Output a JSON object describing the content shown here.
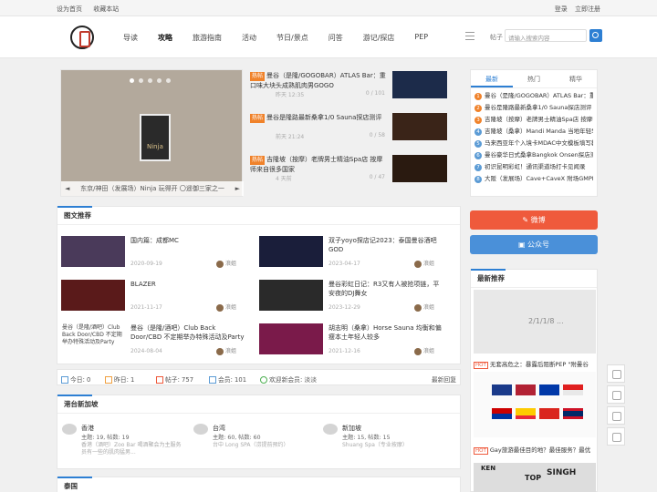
{
  "topbar": {
    "left": [
      "设为首页",
      "收藏本站"
    ],
    "right": [
      "登录",
      "立即注册"
    ]
  },
  "nav": [
    "导读",
    "攻略",
    "旅游指南",
    "活动",
    "节日/景点",
    "问答",
    "游记/探店",
    "PEP"
  ],
  "search": {
    "label": "帖子",
    "placeholder": "请输入搜索内容"
  },
  "slider": {
    "caption": "东京/神田（发展场）Ninja 玩得开 〇遥御三家之一",
    "poster_text": "Ninja"
  },
  "headlines": [
    {
      "tag": "热帖",
      "title": "曼谷（是隆/GOGOBAR）ATLAS Bar：重口味大块头成熟肌肉男GOGO",
      "time": "昨天 12:35",
      "count": "0 / 101"
    },
    {
      "tag": "热帖",
      "title": "曼谷是隆路最新桑拿1/0 Sauna探店测评",
      "time": "前天 21:24",
      "count": "0 / 58"
    },
    {
      "tag": "热帖",
      "title": "吉隆坡（按摩）老牌男士精油Spa店 按摩师来自很多国家",
      "time": "4 天前",
      "count": "0 / 47"
    }
  ],
  "tabs": {
    "labels": [
      "最新",
      "热门",
      "精华"
    ],
    "items": [
      "曼谷（是隆/GOGOBAR）ATLAS Bar：重口",
      "曼谷是隆路最新桑拿1/0 Sauna探店测评",
      "吉隆坡（按摩）老牌男士精油Spa店 按摩师",
      "吉隆坡（桑拿）Mandi Manda 当地年轻华人",
      "马来西亚年个入境卡MDAC中文模板填写教",
      "曼谷豪华日式桑拿Bangkok Onsen探店测记",
      "初识昆明彩虹！通讯渠道场打卡见闻录",
      "大阪（发展场）Cave+CaveX 附场GMPD和"
    ]
  },
  "buttons": {
    "weibo": "微博",
    "wechat": "公众号"
  },
  "gallery": {
    "title": "图文推荐",
    "items": [
      {
        "title": "国内篇：成都MC",
        "date": "2020-09-19",
        "author": "浪姐"
      },
      {
        "title": "双子yoyo探店记2023：泰国曼谷酒吧GOD",
        "date": "2023-04-17",
        "author": "浪姐"
      },
      {
        "title": "BLAZER",
        "date": "2021-11-17",
        "author": "浪姐"
      },
      {
        "title": "曼谷彩虹日记：R3又有人被抢项链，平安夜的DJ舞女",
        "date": "2023-12-29",
        "author": "浪姐"
      },
      {
        "title": "曼谷（是隆/酒吧）Club Back Door/CBD 不定期举办特殊活动及Party",
        "date": "2024-08-04",
        "author": "浪姐"
      },
      {
        "title": "胡志明（桑拿）Horse Sauna 均衡和偏瘦本土年轻人较多",
        "date": "2021-12-16",
        "author": "浪姐"
      }
    ],
    "broken_alt": "曼谷（是隆/酒吧）Club Back Door/CBD 不定期举办特殊活动及Party"
  },
  "stats": {
    "today": "今日: 0",
    "yesterday": "昨日: 1",
    "posts": "帖子: 757",
    "members": "会员: 101",
    "welcome": "欢迎新会员: 淡淡",
    "latest": "最新回复"
  },
  "recommend": {
    "title": "最新推荐",
    "item1_tag": "HOT",
    "item1": "无套高危之：暴露后阻断PEP \"附曼谷",
    "item2_tag": "HOT",
    "item2": "Gay旅游最佳目的地？最佳服务？最优",
    "img_text1": "KEN",
    "img_text2": "SINGH",
    "img_text3": "TOP"
  },
  "gangtai": {
    "title": "港台新加坡",
    "regions": [
      {
        "name": "香港",
        "stats": "主题: 19, 帖数: 19",
        "last": "香港（酒吧）Zoo Bar 喝酒聚会为主服务员有一些的肌肉猛男..."
      },
      {
        "name": "台湾",
        "stats": "主题: 60, 帖数: 60",
        "last": "台中 Long SPA（涝提前预约）"
      },
      {
        "name": "新加坡",
        "stats": "主题: 15, 帖数: 15",
        "last": "Shuang Spa（专业按摩）"
      }
    ]
  },
  "thai": {
    "title": "泰国"
  },
  "colors": {
    "accent": "#2d7fd3",
    "hot": "#f0822a",
    "weibo": "#ef5a3c",
    "wechat": "#4a90d9"
  }
}
